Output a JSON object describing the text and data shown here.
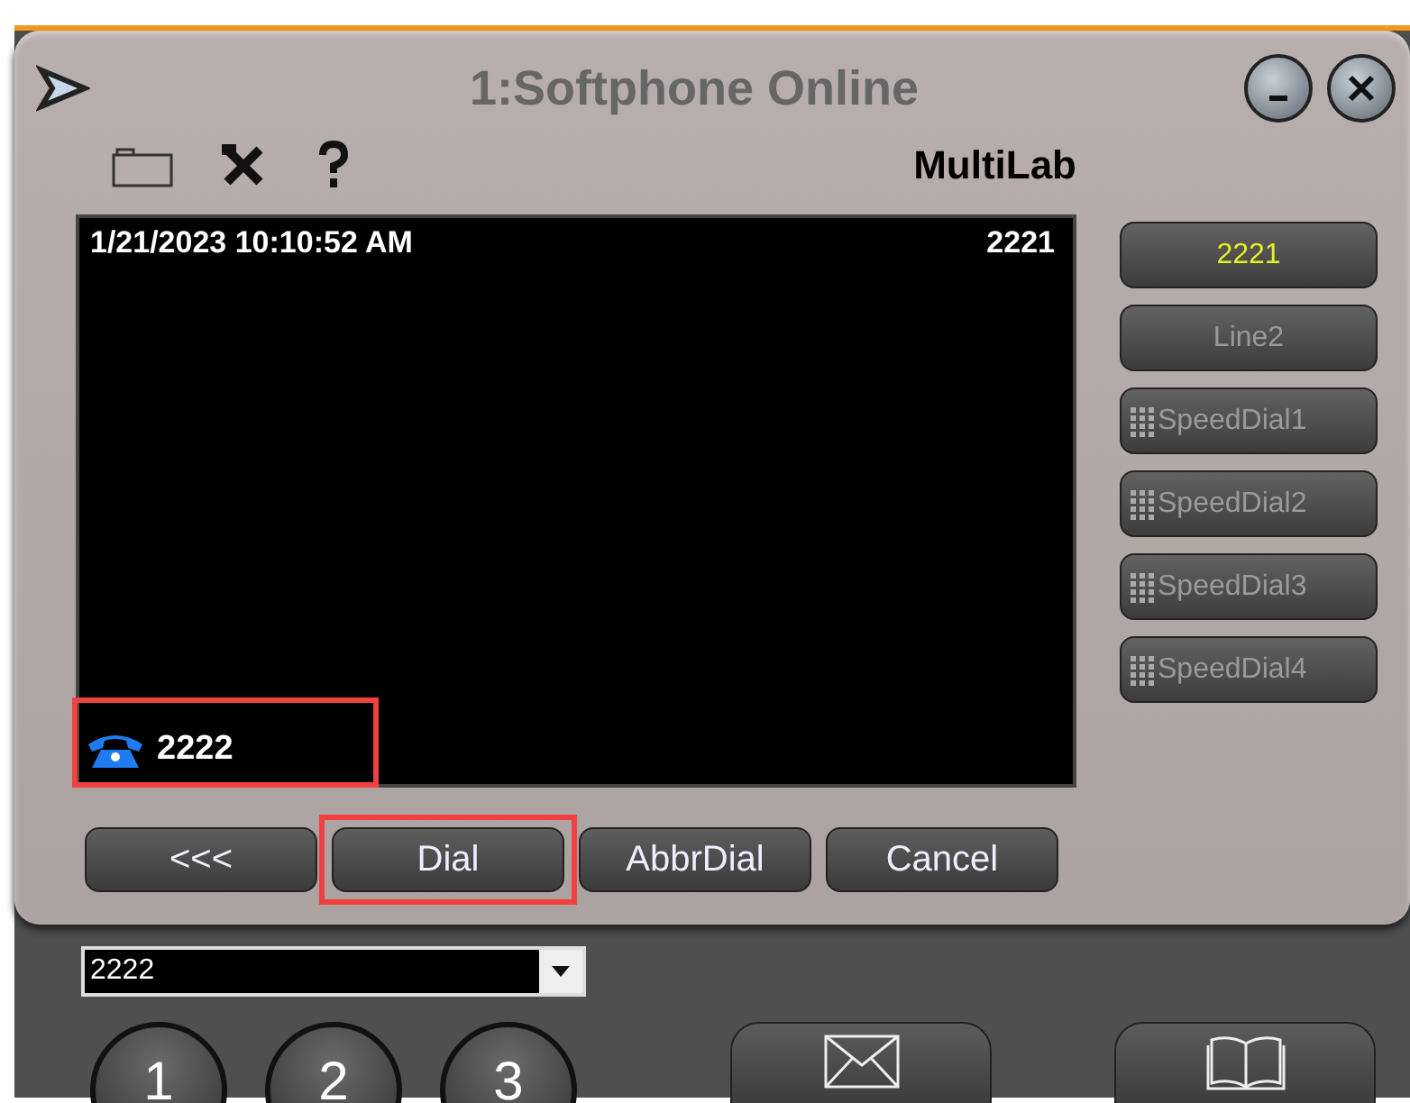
{
  "window": {
    "title": "1:Softphone Online"
  },
  "toolbar": {
    "account": "MultiLab"
  },
  "display": {
    "datetime": "1/21/2023 10:10:52 AM",
    "line": "2221",
    "number": "2222",
    "number_highlighted": true
  },
  "line_buttons": [
    {
      "kind": "line",
      "label": "2221",
      "selected": true
    },
    {
      "kind": "line",
      "label": "Line2",
      "selected": false
    },
    {
      "kind": "speeddial",
      "label": "SpeedDial1",
      "selected": false
    },
    {
      "kind": "speeddial",
      "label": "SpeedDial2",
      "selected": false
    },
    {
      "kind": "speeddial",
      "label": "SpeedDial3",
      "selected": false
    },
    {
      "kind": "speeddial",
      "label": "SpeedDial4",
      "selected": false
    }
  ],
  "actions": [
    {
      "label": "<<<",
      "highlighted": false
    },
    {
      "label": "Dial",
      "highlighted": true
    },
    {
      "label": "AbbrDial",
      "highlighted": false
    },
    {
      "label": "Cancel",
      "highlighted": false
    }
  ],
  "dial_combo": {
    "value": "2222"
  },
  "keypad": [
    "1",
    "2",
    "3"
  ]
}
